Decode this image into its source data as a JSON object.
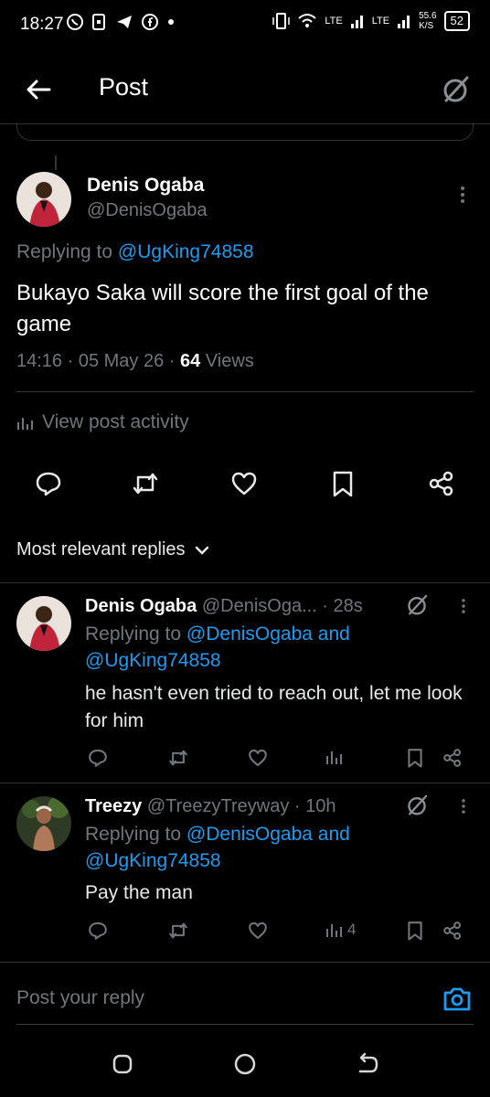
{
  "status_bar": {
    "time": "18:27",
    "network_speed": "55.6",
    "network_speed_unit": "K/S",
    "battery": "52",
    "lte1": "LTE",
    "lte2": "LTE"
  },
  "header": {
    "title": "Post"
  },
  "main_post": {
    "author_name": "Denis Ogaba",
    "author_handle": "@DenisOgaba",
    "replying_prefix": "Replying to ",
    "replying_to": "@UgKing74858",
    "text": "Bukayo Saka will score the first goal of the game",
    "time": "14:16 · 05 May 26 · ",
    "views_count": "64",
    "views_label": " Views",
    "view_activity": "View post activity"
  },
  "section": {
    "sort_label": "Most relevant replies"
  },
  "replies": [
    {
      "author_name": "Denis Ogaba",
      "author_handle": "@DenisOga...",
      "time": " · 28s",
      "replying_prefix": "Replying to ",
      "replying_to_1": "@DenisOgaba",
      "replying_and": " and",
      "replying_to_2": "@UgKing74858",
      "text": "he hasn't even tried to reach out, let me look for him",
      "views": ""
    },
    {
      "author_name": "Treezy",
      "author_handle": "@TreezyTreyway",
      "time": " · 10h",
      "replying_prefix": "Replying to ",
      "replying_to_1": "@DenisOgaba",
      "replying_and": " and",
      "replying_to_2": "@UgKing74858",
      "text": "Pay the man",
      "views": "4"
    }
  ],
  "compose": {
    "placeholder": "Post your reply"
  },
  "colors": {
    "accent": "#1d9bf0",
    "muted": "#71767b",
    "divider": "#2f3336",
    "background": "#000000"
  },
  "icons": [
    "back-arrow-icon",
    "grok-icon",
    "more-icon",
    "bar-chart-icon",
    "reply-icon",
    "repost-icon",
    "like-icon",
    "bookmark-icon",
    "share-icon",
    "chevron-down-icon",
    "camera-icon",
    "nav-recents-icon",
    "nav-home-icon",
    "nav-back-icon"
  ]
}
